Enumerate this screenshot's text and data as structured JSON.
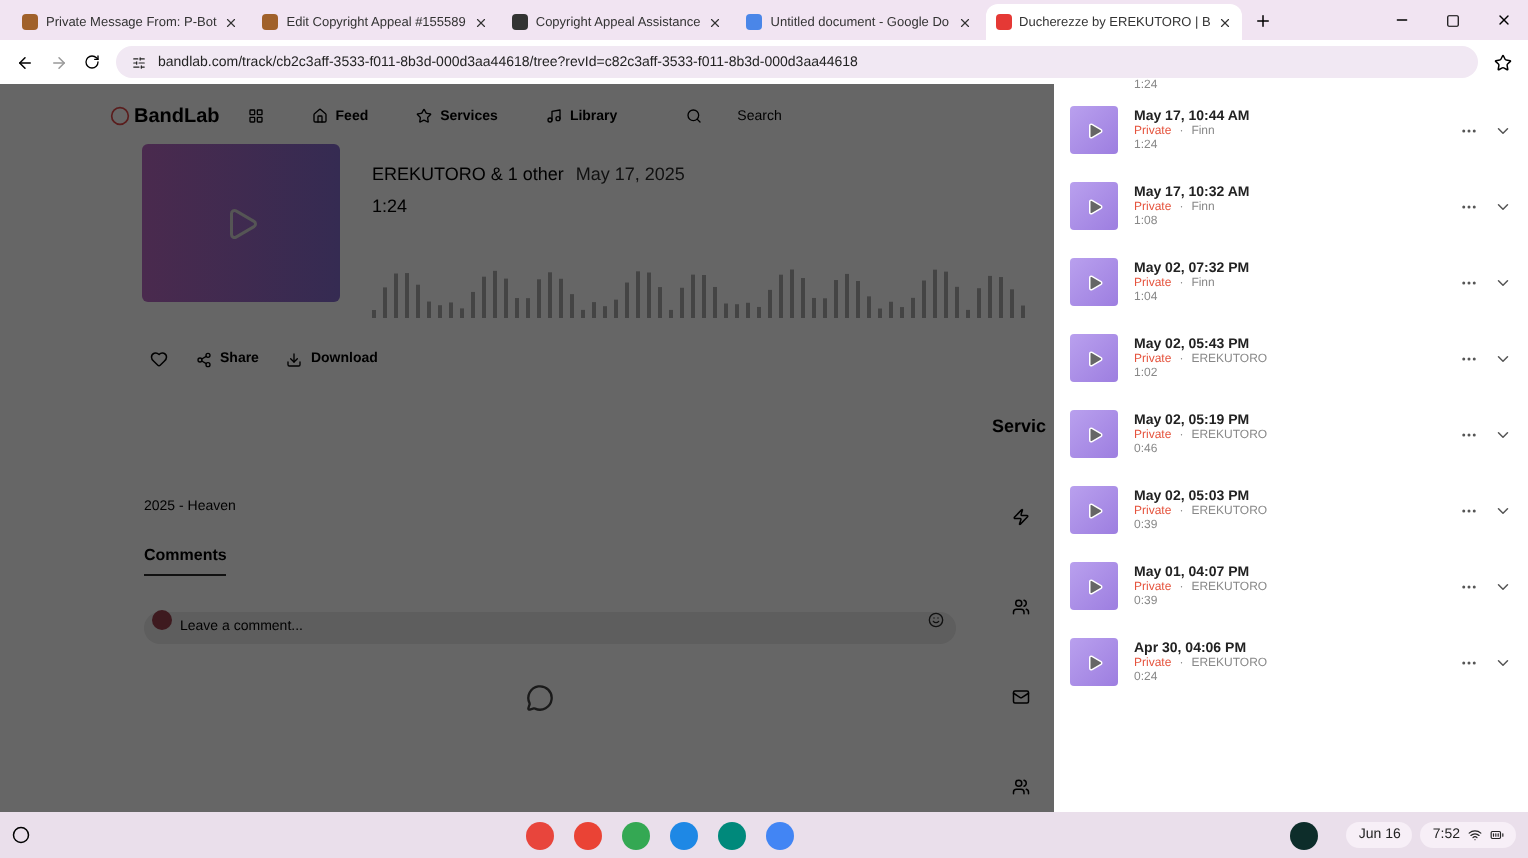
{
  "browser": {
    "tabs": [
      {
        "title": "Private Message From: P-Bot",
        "selected": false
      },
      {
        "title": "Edit Copyright Appeal #155589",
        "selected": false
      },
      {
        "title": "Copyright Appeal Assistance",
        "selected": false
      },
      {
        "title": "Untitled document - Google Do",
        "selected": false
      },
      {
        "title": "Ducherezze by EREKUTORO | B",
        "selected": true
      }
    ],
    "url": "bandlab.com/track/cb2c3aff-3533-f011-8b3d-000d3aa44618/tree?revId=c82c3aff-3533-f011-8b3d-000d3aa44618"
  },
  "page": {
    "logo": "BandLab",
    "nav": [
      "Feed",
      "Services",
      "Library"
    ],
    "search": {
      "placeholder": "Search"
    },
    "track": {
      "artist": "EREKUTORO & 1 other",
      "date": "May 17, 2025",
      "duration": "1:24"
    },
    "actions": [
      "Share",
      "Download"
    ],
    "services_heading": "Servic",
    "description": "2025 - Heaven",
    "comments_tab": "Comments",
    "comment_field": {
      "placeholder": "Leave a comment..."
    }
  },
  "revisions": {
    "partial_duration": "1:24",
    "separator": "·",
    "items": [
      {
        "title": "May 17, 10:44 AM",
        "visibility": "Private",
        "author": "Finn",
        "duration": "1:24"
      },
      {
        "title": "May 17, 10:32 AM",
        "visibility": "Private",
        "author": "Finn",
        "duration": "1:08"
      },
      {
        "title": "May 02, 07:32 PM",
        "visibility": "Private",
        "author": "Finn",
        "duration": "1:04"
      },
      {
        "title": "May 02, 05:43 PM",
        "visibility": "Private",
        "author": "EREKUTORO",
        "duration": "1:02"
      },
      {
        "title": "May 02, 05:19 PM",
        "visibility": "Private",
        "author": "EREKUTORO",
        "duration": "0:46"
      },
      {
        "title": "May 02, 05:03 PM",
        "visibility": "Private",
        "author": "EREKUTORO",
        "duration": "0:39"
      },
      {
        "title": "May 01, 04:07 PM",
        "visibility": "Private",
        "author": "EREKUTORO",
        "duration": "0:39"
      },
      {
        "title": "Apr 30, 04:06 PM",
        "visibility": "Private",
        "author": "EREKUTORO",
        "duration": "0:24"
      }
    ]
  },
  "taskbar": {
    "date": "Jun 16",
    "time": "7:52"
  }
}
